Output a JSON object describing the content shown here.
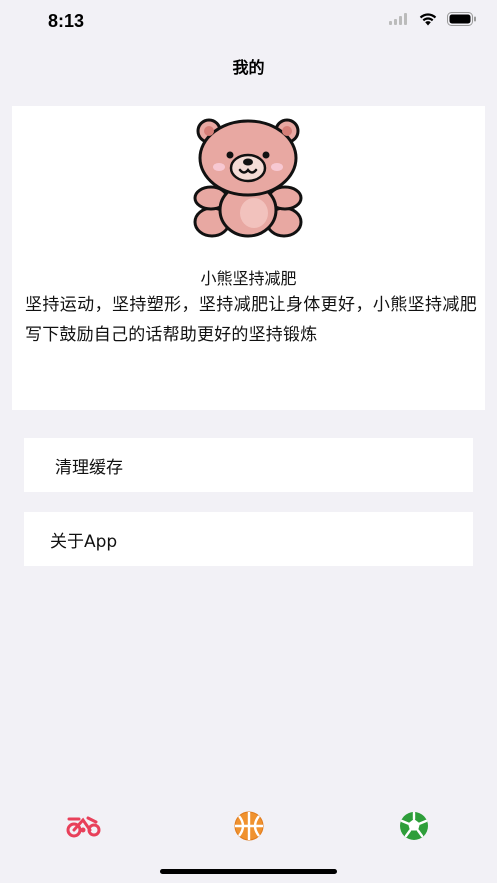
{
  "status_bar": {
    "time": "8:13",
    "icons": [
      "signal-icon",
      "wifi-icon",
      "battery-icon"
    ]
  },
  "header": {
    "title": "我的"
  },
  "profile": {
    "avatar": "teddy-bear",
    "name": "小熊坚持减肥",
    "description": "坚持运动，坚持塑形，坚持减肥让身体更好，小熊坚持减肥写下鼓励自己的话帮助更好的坚持锻炼"
  },
  "settings": {
    "clear_cache_label": "清理缓存",
    "about_label": "关于App"
  },
  "tab_bar": {
    "items": [
      {
        "icon": "exercise-bike-icon",
        "color": "#e8405a"
      },
      {
        "icon": "basketball-icon",
        "color": "#f0922f"
      },
      {
        "icon": "soccer-ball-icon",
        "color": "#2e9e3a"
      }
    ]
  }
}
